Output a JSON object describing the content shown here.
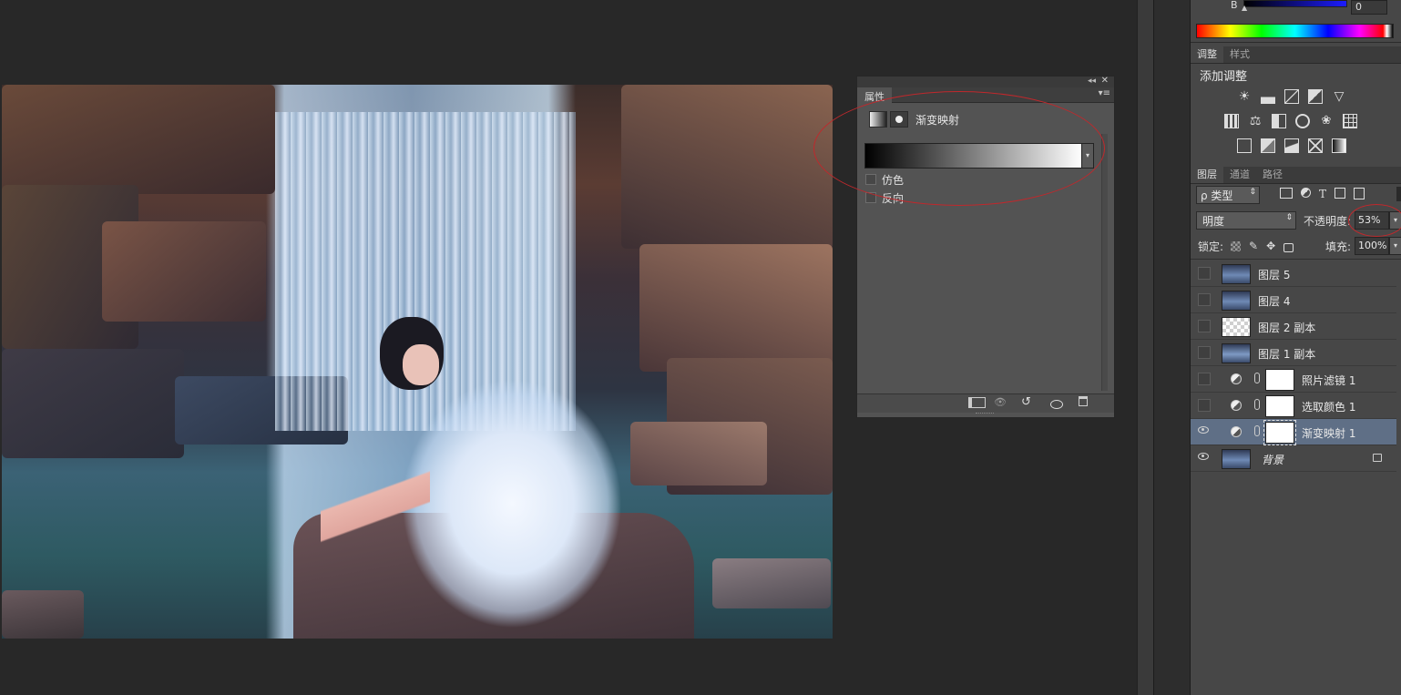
{
  "top_panel": {
    "channel_label": "B",
    "channel_value": "0"
  },
  "adjustments": {
    "tabs": [
      "调整",
      "样式"
    ],
    "title": "添加调整",
    "rows": [
      [
        "brightness-contrast-icon",
        "levels-icon",
        "curves-icon",
        "exposure-icon",
        "gradient-triangle-icon"
      ],
      [
        "vibrance-icon",
        "color-balance-icon",
        "black-white-icon",
        "photo-filter-icon",
        "channel-mixer-icon"
      ],
      [
        "invert-icon",
        "posterize-icon",
        "threshold-icon",
        "selective-color-icon",
        "gradient-map-icon"
      ]
    ]
  },
  "layers_panel": {
    "tabs": [
      "图层",
      "通道",
      "路径"
    ],
    "filter_label": "ρ 类型",
    "blend_mode": "明度",
    "opacity_label": "不透明度:",
    "opacity_value": "53%",
    "lock_label": "锁定:",
    "fill_label": "填充:",
    "fill_value": "100%",
    "layers": [
      {
        "name": "图层 5",
        "type": "pixel",
        "visible": false,
        "selected": false
      },
      {
        "name": "图层 4",
        "type": "pixel",
        "visible": false,
        "selected": false
      },
      {
        "name": "图层 2 副本",
        "type": "transparent",
        "visible": false,
        "selected": false
      },
      {
        "name": "图层 1 副本",
        "type": "pixel",
        "visible": false,
        "selected": false
      },
      {
        "name": "照片滤镜 1",
        "type": "adjustment",
        "visible": false,
        "selected": false
      },
      {
        "name": "选取颜色 1",
        "type": "adjustment",
        "visible": false,
        "selected": false
      },
      {
        "name": "渐变映射 1",
        "type": "adjustment",
        "visible": true,
        "selected": true
      },
      {
        "name": "背景",
        "type": "background",
        "visible": true,
        "selected": false,
        "locked": true
      }
    ]
  },
  "properties_panel": {
    "tab": "属性",
    "adjustment_name": "渐变映射",
    "options": [
      {
        "label": "仿色",
        "checked": false
      },
      {
        "label": "反向",
        "checked": false
      }
    ]
  },
  "colors": {
    "selection": "#5f6f86",
    "annotation": "#c0282c"
  }
}
